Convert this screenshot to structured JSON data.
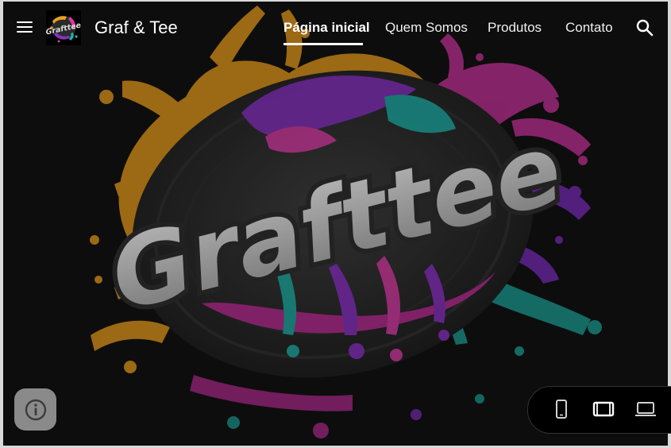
{
  "header": {
    "site_title": "Graf & Tee",
    "logo_text": "Grafttee",
    "menu_icon": "hamburger-menu-icon",
    "search_icon": "search-icon"
  },
  "nav": {
    "items": [
      {
        "label": "Página inicial",
        "active": true
      },
      {
        "label": "Quem Somos",
        "active": false
      },
      {
        "label": "Produtos",
        "active": false
      },
      {
        "label": "Contato",
        "active": false
      }
    ]
  },
  "hero": {
    "wordmark": "Grafttee",
    "colors": {
      "orange": "#e8a11f",
      "magenta": "#d63aa0",
      "purple": "#8a2fc9",
      "teal": "#1fb3a6",
      "letter": "#bdbdbd",
      "background": "#111111"
    }
  },
  "overlay": {
    "info_icon": "info-icon",
    "device_options": [
      "phone-icon",
      "tablet-icon",
      "laptop-icon"
    ],
    "selected_device": "tablet-icon"
  }
}
